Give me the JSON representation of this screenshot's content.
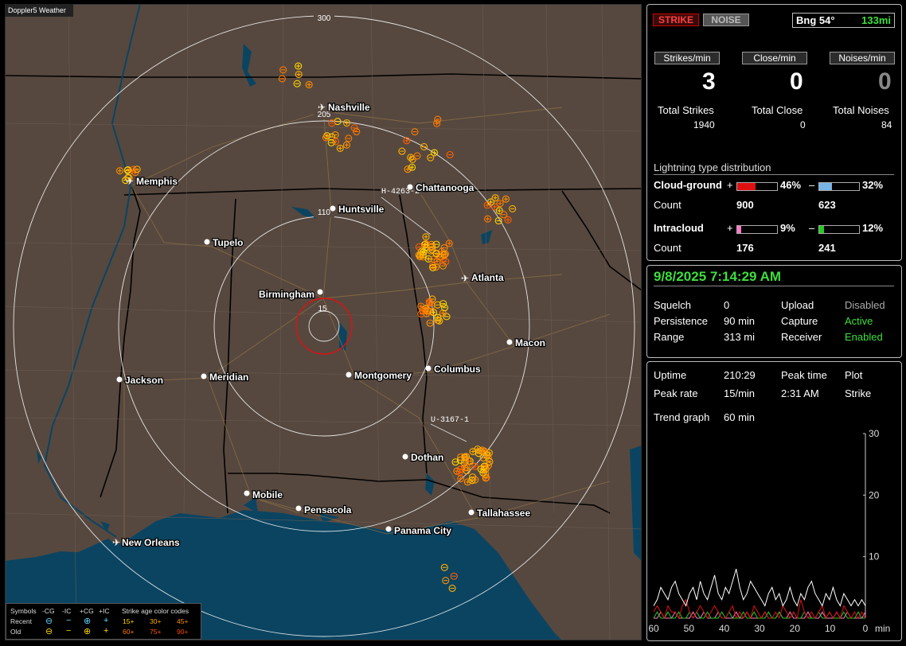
{
  "app": {
    "title": "Doppler5 Weather"
  },
  "colors": {
    "land": "#56483f",
    "water": "#0b4461",
    "accent_green": "#3ede3e",
    "strike_red": "#e01010",
    "cg_neg": "#78b4e6",
    "ic_pos": "#ff78c8",
    "ic_neg": "#22cc22"
  },
  "map": {
    "range_rings": [
      "15",
      "110",
      "205",
      "300"
    ],
    "cities": [
      {
        "name": "Nashville",
        "airport": true
      },
      {
        "name": "Memphis",
        "airport": true
      },
      {
        "name": "Chattanooga",
        "airport": false
      },
      {
        "name": "Huntsville",
        "airport": false
      },
      {
        "name": "Tupelo",
        "airport": false
      },
      {
        "name": "Atlanta",
        "airport": true
      },
      {
        "name": "Birmingham",
        "airport": false
      },
      {
        "name": "Macon",
        "airport": false
      },
      {
        "name": "Jackson",
        "airport": false
      },
      {
        "name": "Meridian",
        "airport": false
      },
      {
        "name": "Montgomery",
        "airport": false
      },
      {
        "name": "Columbus",
        "airport": false
      },
      {
        "name": "Dothan",
        "airport": false
      },
      {
        "name": "Mobile",
        "airport": false
      },
      {
        "name": "Pensacola",
        "airport": false
      },
      {
        "name": "Tallahassee",
        "airport": false
      },
      {
        "name": "Panama City",
        "airport": false
      },
      {
        "name": "New Orleans",
        "airport": true
      }
    ],
    "stations": [
      "H-4263-2",
      "U-3167-1"
    ]
  },
  "legend": {
    "title_symbols": "Symbols",
    "col_neg_cg": "-CG",
    "col_neg_ic": "-IC",
    "col_pos_cg": "+CG",
    "col_pos_ic": "+IC",
    "title_age": "Strike age color codes",
    "row_recent": "Recent",
    "row_old": "Old",
    "age_recent": [
      "15+",
      "30+",
      "45+"
    ],
    "age_old": [
      "60+",
      "75+",
      "90+"
    ]
  },
  "status": {
    "strike_button": "STRIKE",
    "noise_button": "NOISE",
    "bearing": "Bng 54°",
    "distance": "133mi",
    "strikes_per_min_label": "Strikes/min",
    "close_per_min_label": "Close/min",
    "noises_per_min_label": "Noises/min",
    "strikes_per_min": "3",
    "close_per_min": "0",
    "noises_per_min": "0",
    "total_strikes_label": "Total Strikes",
    "total_close_label": "Total Close",
    "total_noises_label": "Total Noises",
    "total_strikes": "1940",
    "total_close": "0",
    "total_noises": "84"
  },
  "distribution": {
    "title": "Lightning type distribution",
    "cloud_ground_label": "Cloud-ground",
    "intracloud_label": "Intracloud",
    "count_label": "Count",
    "plus": "+",
    "minus": "–",
    "cg_pos_pct_text": "46%",
    "cg_neg_pct_text": "32%",
    "ic_pos_pct_text": "9%",
    "ic_neg_pct_text": "12%",
    "cg_pos_fraction": 0.46,
    "cg_neg_fraction": 0.32,
    "ic_pos_fraction": 0.09,
    "ic_neg_fraction": 0.12,
    "cg_pos_count": "900",
    "cg_neg_count": "623",
    "ic_pos_count": "176",
    "ic_neg_count": "241"
  },
  "settings": {
    "datetime": "9/8/2025 7:14:29 AM",
    "squelch_label": "Squelch",
    "squelch": "0",
    "persistence_label": "Persistence",
    "persistence": "90 min",
    "range_label": "Range",
    "range": "313 mi",
    "upload_label": "Upload",
    "upload": "Disabled",
    "capture_label": "Capture",
    "capture": "Active",
    "receiver_label": "Receiver",
    "receiver": "Enabled"
  },
  "stats": {
    "uptime_label": "Uptime",
    "uptime": "210:29",
    "peak_time_label": "Peak time",
    "peak_time": "2:31 AM",
    "plot_label": "Plot",
    "plot": "Strike",
    "peak_rate_label": "Peak rate",
    "peak_rate": "15/min",
    "trend_label": "Trend graph",
    "trend": "60 min"
  },
  "chart_data": {
    "type": "line",
    "x_ticks": [
      "60",
      "50",
      "40",
      "30",
      "20",
      "10",
      "0"
    ],
    "x_unit": "min",
    "y_ticks": [
      "10",
      "20",
      "30"
    ],
    "ylim": [
      0,
      30
    ],
    "xlim": [
      60,
      0
    ],
    "series": [
      {
        "color": "#ffffff",
        "values": [
          2,
          3,
          5,
          4,
          3,
          5,
          6,
          4,
          3,
          2,
          4,
          5,
          3,
          6,
          4,
          3,
          5,
          7,
          4,
          3,
          5,
          4,
          6,
          8,
          5,
          3,
          4,
          6,
          5,
          4,
          3,
          2,
          4,
          5,
          3,
          4,
          2,
          3,
          5,
          3,
          2,
          4,
          3,
          5,
          6,
          4,
          3,
          2,
          4,
          3,
          5,
          3,
          2,
          4,
          3,
          2,
          3,
          2,
          3,
          2
        ]
      },
      {
        "color": "#e01010",
        "values": [
          1,
          2,
          1,
          0,
          2,
          1,
          1,
          0,
          2,
          3,
          1,
          0,
          1,
          2,
          1,
          0,
          1,
          2,
          1,
          0,
          0,
          1,
          2,
          0,
          1,
          0,
          1,
          0,
          2,
          1,
          0,
          1,
          0,
          0,
          1,
          0,
          2,
          1,
          0,
          1,
          0,
          3,
          1,
          0,
          1,
          0,
          1,
          2,
          0,
          1,
          0,
          1,
          0,
          2,
          1,
          0,
          1,
          0,
          1,
          0
        ]
      },
      {
        "color": "#22cc22",
        "values": [
          0,
          1,
          0,
          0,
          1,
          0,
          0,
          1,
          0,
          0,
          1,
          0,
          1,
          0,
          0,
          1,
          0,
          0,
          0,
          1,
          0,
          1,
          0,
          0,
          0,
          1,
          0,
          0,
          1,
          0,
          0,
          0,
          1,
          0,
          0,
          1,
          0,
          0,
          0,
          1,
          0,
          0,
          1,
          0,
          0,
          0,
          1,
          0,
          0,
          1,
          0,
          0,
          0,
          1,
          0,
          0,
          0,
          1,
          0,
          0
        ]
      },
      {
        "color": "#ff78c8",
        "values": [
          0,
          0,
          1,
          0,
          0,
          0,
          1,
          0,
          0,
          0,
          0,
          1,
          0,
          0,
          1,
          0,
          0,
          0,
          1,
          0,
          0,
          0,
          0,
          1,
          0,
          0,
          1,
          0,
          0,
          0,
          0,
          1,
          0,
          0,
          0,
          1,
          0,
          0,
          1,
          0,
          0,
          0,
          0,
          1,
          0,
          0,
          0,
          1,
          0,
          0,
          0,
          1,
          0,
          0,
          1,
          0,
          0,
          0,
          0,
          1
        ]
      }
    ]
  }
}
